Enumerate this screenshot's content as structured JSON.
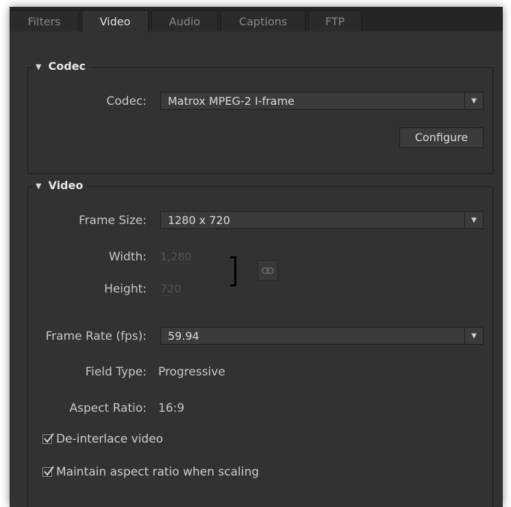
{
  "tabs": [
    {
      "label": "Filters",
      "active": false
    },
    {
      "label": "Video",
      "active": true
    },
    {
      "label": "Audio",
      "active": false
    },
    {
      "label": "Captions",
      "active": false
    },
    {
      "label": "FTP",
      "active": false
    }
  ],
  "codec_section": {
    "title": "Codec",
    "codec_label": "Codec:",
    "codec_value": "Matrox MPEG-2 I-frame",
    "configure_label": "Configure"
  },
  "video_section": {
    "title": "Video",
    "frame_size_label": "Frame Size:",
    "frame_size_value": "1280 x 720",
    "width_label": "Width:",
    "width_value": "1,280",
    "height_label": "Height:",
    "height_value": "720",
    "frame_rate_label": "Frame Rate (fps):",
    "frame_rate_value": "59.94",
    "field_type_label": "Field Type:",
    "field_type_value": "Progressive",
    "aspect_ratio_label": "Aspect Ratio:",
    "aspect_ratio_value": "16:9",
    "deinterlace_label": "De-interlace video",
    "deinterlace_checked": true,
    "maintain_aspect_label": "Maintain aspect ratio when scaling",
    "maintain_aspect_checked": true
  },
  "icons": {
    "dropdown": "chevron-down-icon",
    "section_toggle": "disclosure-triangle-icon",
    "constrain": "chain-link-icon",
    "check": "checkmark-icon"
  },
  "colors": {
    "panel_bg": "#323232",
    "tabbar_bg": "#252525",
    "text": "#c8c8c8",
    "disabled_text": "#555555"
  }
}
